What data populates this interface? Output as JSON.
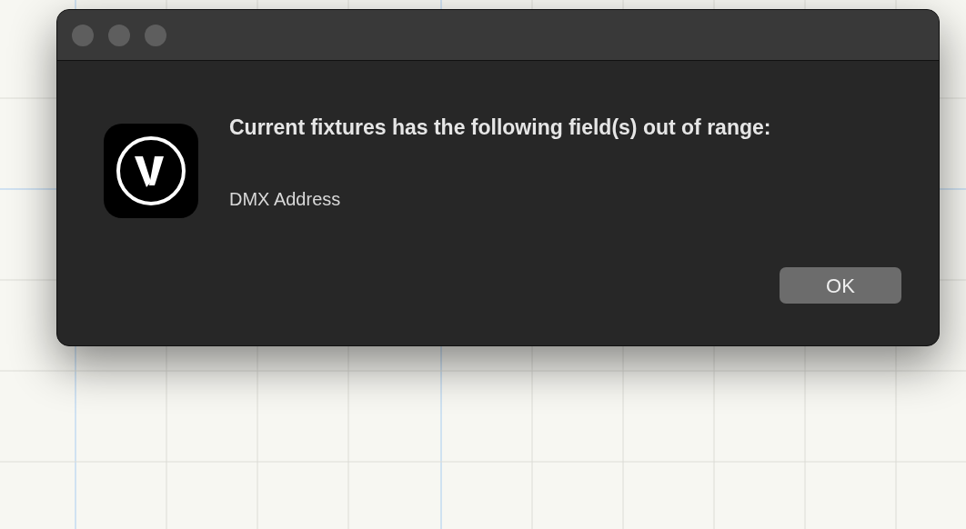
{
  "dialog": {
    "message": "Current fixtures has the following field(s) out of range:",
    "detail": "DMX Address",
    "buttons": [
      "OK"
    ]
  }
}
